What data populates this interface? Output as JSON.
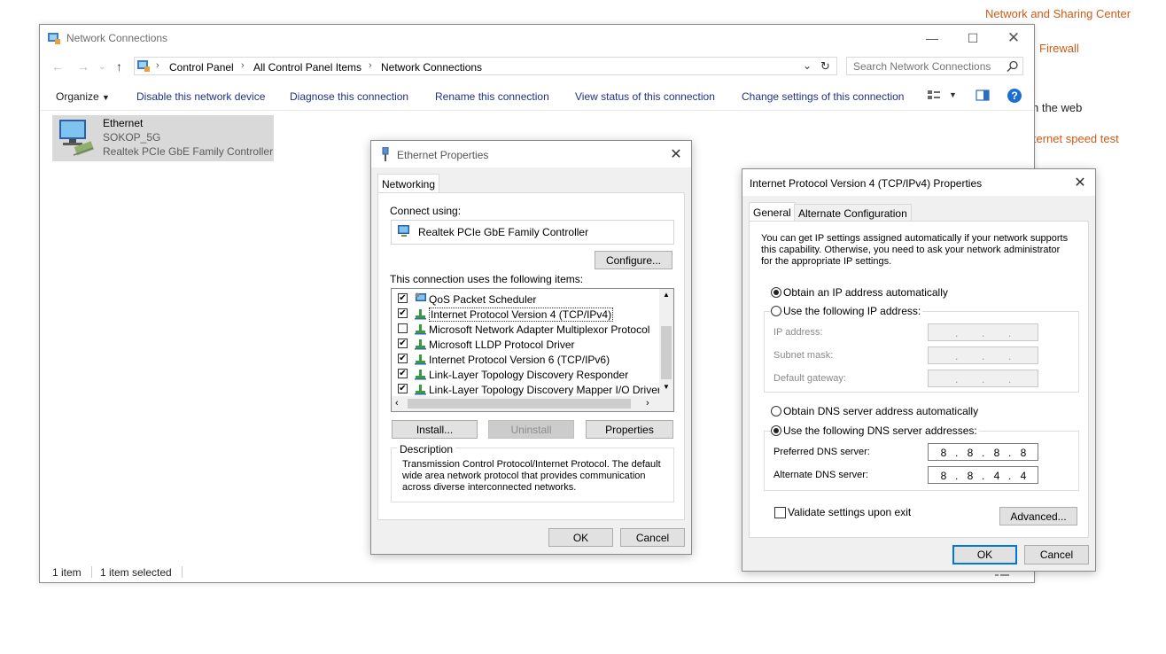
{
  "background": {
    "network_sharing_center": "Network and Sharing Center",
    "firewall_fragment": "Firewall",
    "web_fragment": "n the web",
    "speedtest_fragment": "iternet speed test"
  },
  "explorer": {
    "title": "Network Connections",
    "breadcrumb": [
      "Control Panel",
      "All Control Panel Items",
      "Network Connections"
    ],
    "search_placeholder": "Search Network Connections",
    "commands": {
      "organize": "Organize",
      "disable": "Disable this network device",
      "diagnose": "Diagnose this connection",
      "rename": "Rename this connection",
      "view_status": "View status of this connection",
      "change_settings": "Change settings of this connection"
    },
    "item": {
      "name": "Ethernet",
      "network": "SOKOP_5G",
      "adapter": "Realtek PCIe GbE Family Controller"
    },
    "status": {
      "count": "1 item",
      "selected": "1 item selected"
    }
  },
  "ethernet_dialog": {
    "title": "Ethernet Properties",
    "tab": "Networking",
    "connect_using_label": "Connect using:",
    "adapter": "Realtek PCIe GbE Family Controller",
    "configure_button": "Configure...",
    "items_label": "This connection uses the following items:",
    "items": [
      {
        "label": "QoS Packet Scheduler",
        "checked": true
      },
      {
        "label": "Internet Protocol Version 4 (TCP/IPv4)",
        "checked": true
      },
      {
        "label": "Microsoft Network Adapter Multiplexor Protocol",
        "checked": false
      },
      {
        "label": "Microsoft LLDP Protocol Driver",
        "checked": true
      },
      {
        "label": "Internet Protocol Version 6 (TCP/IPv6)",
        "checked": true
      },
      {
        "label": "Link-Layer Topology Discovery Responder",
        "checked": true
      },
      {
        "label": "Link-Layer Topology Discovery Mapper I/O Driver",
        "checked": true
      }
    ],
    "install_button": "Install...",
    "uninstall_button": "Uninstall",
    "properties_button": "Properties",
    "description_label": "Description",
    "description_lines": [
      "Transmission Control Protocol/Internet Protocol. The default",
      "wide area network protocol that provides communication",
      "across diverse interconnected networks."
    ],
    "ok_button": "OK",
    "cancel_button": "Cancel"
  },
  "ipv4_dialog": {
    "title": "Internet Protocol Version 4 (TCP/IPv4) Properties",
    "tab_general": "General",
    "tab_alternate": "Alternate Configuration",
    "info_lines": [
      "You can get IP settings assigned automatically if your network supports",
      "this capability. Otherwise, you need to ask your network administrator",
      "for the appropriate IP settings."
    ],
    "obtain_ip_auto": "Obtain an IP address automatically",
    "use_following_ip": "Use the following IP address:",
    "ip_address_label": "IP address:",
    "subnet_mask_label": "Subnet mask:",
    "default_gateway_label": "Default gateway:",
    "obtain_dns_auto": "Obtain DNS server address automatically",
    "use_following_dns": "Use the following DNS server addresses:",
    "preferred_dns_label": "Preferred DNS server:",
    "alternate_dns_label": "Alternate DNS server:",
    "preferred_dns": [
      "8",
      "8",
      "8",
      "8"
    ],
    "alternate_dns": [
      "8",
      "8",
      "4",
      "4"
    ],
    "validate_label": "Validate settings upon exit",
    "advanced_button": "Advanced...",
    "ok_button": "OK",
    "cancel_button": "Cancel"
  }
}
